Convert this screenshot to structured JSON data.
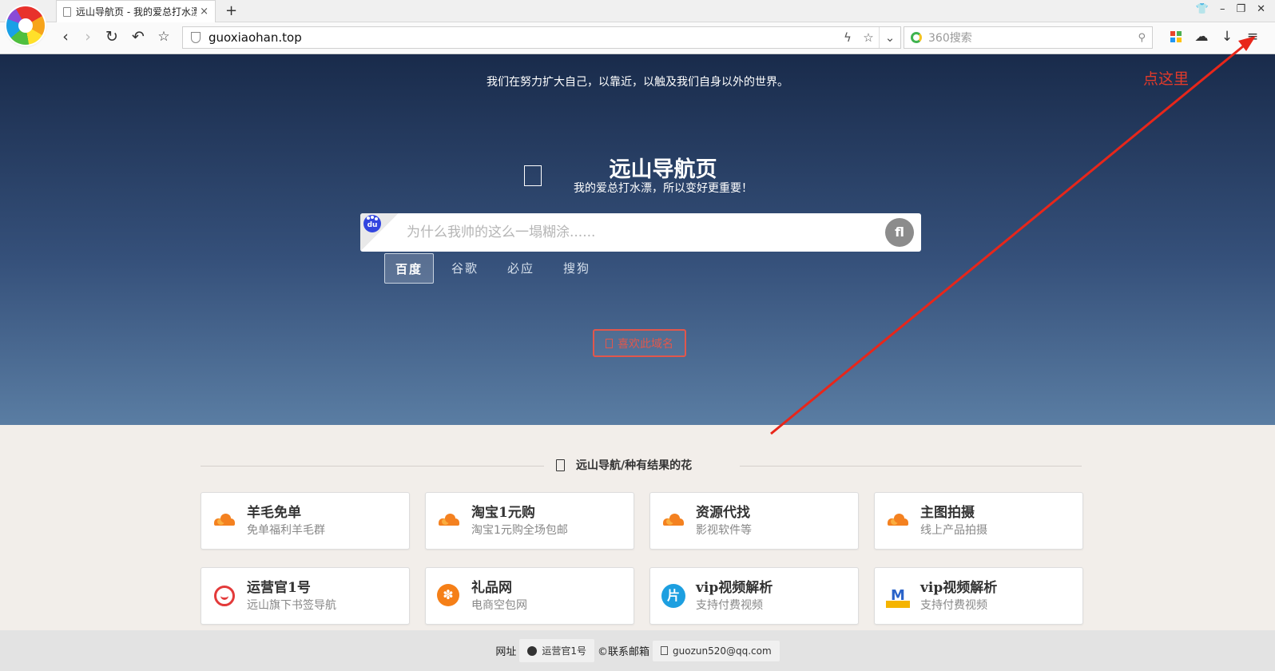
{
  "browser": {
    "tab_title": "远山导航页 - 我的爱总打水漂",
    "tab_close": "×",
    "new_tab": "+",
    "window_controls": [
      "👕",
      "–",
      "❐",
      "✕"
    ],
    "url": "guoxiaohan.top",
    "search_placeholder": "360搜索",
    "nav_icons": [
      "back-icon",
      "forward-icon",
      "reload-icon",
      "undo-icon",
      "bookmark-star-icon"
    ],
    "right_icons": [
      "apps-icon",
      "cloud-icon",
      "download-icon",
      "menu-icon"
    ]
  },
  "hero": {
    "motto": "我们在努力扩大自己，以靠近，以触及我们自身以外的世界。",
    "site_title": "远山导航页",
    "site_subtitle": "我的爱总打水漂，所以变好更重要！",
    "search_placeholder": "为什么我帅的这么一塌糊涂......",
    "engine_logo_text": "du",
    "go_glyph": "fl",
    "engines": [
      "百度",
      "谷歌",
      "必应",
      "搜狗"
    ],
    "active_engine": "百度",
    "like_button": "喜欢此域名"
  },
  "section": {
    "title": "远山导航/种有结果的花"
  },
  "cards": [
    {
      "title": "羊毛免单",
      "desc": "免单福利羊毛群",
      "icon": "cloud-icon"
    },
    {
      "title": "淘宝1元购",
      "desc": "淘宝1元购全场包邮",
      "icon": "cloud-icon"
    },
    {
      "title": "资源代找",
      "desc": "影视软件等",
      "icon": "cloud-icon"
    },
    {
      "title": "主图拍摄",
      "desc": "线上产品拍摄",
      "icon": "cloud-icon"
    },
    {
      "title": "运营官1号",
      "desc": "远山旗下书签导航",
      "icon": "monkey-icon"
    },
    {
      "title": "礼品网",
      "desc": "电商空包网",
      "icon": "gift-icon"
    },
    {
      "title": "vip视频解析",
      "desc": "支持付费视频",
      "icon": "pian-icon",
      "glyph": "片"
    },
    {
      "title": "vip视频解析",
      "desc": "支持付费视频",
      "icon": "m-logo-icon",
      "glyph": "M"
    }
  ],
  "footer": {
    "label": "网址",
    "github_link": "运营官1号",
    "contact_label": "©联系邮箱",
    "email": "guozun520@qq.com"
  },
  "annotation": {
    "text": "点这里",
    "color": "#e23a2a"
  },
  "colors": {
    "hero_top": "#192b4b",
    "hero_bottom": "#5a7da3",
    "accent_red": "#e2574c",
    "cloud_orange": "#f48120"
  }
}
